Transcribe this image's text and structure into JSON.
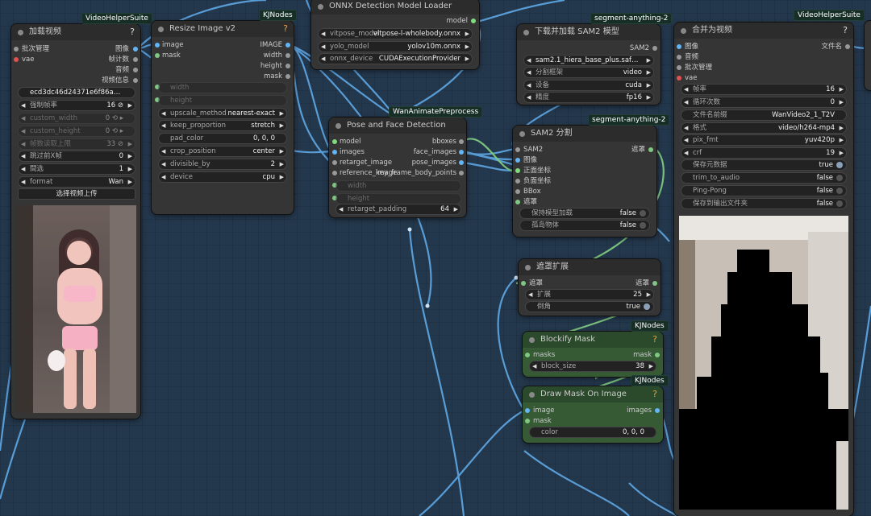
{
  "nodes": {
    "load_video": {
      "title": "加载视频",
      "badge": "VideoHelperSuite",
      "inputs": [
        "批次管理",
        "vae"
      ],
      "outputs": [
        "图像",
        "帧计数",
        "音频",
        "视频信息"
      ],
      "video_name": "ecd3dc46d24371e6f86a5d9 ...",
      "force_rate": {
        "label": "强制帧率",
        "value": "16 ⊘"
      },
      "custom_width": {
        "label": "custom_width",
        "value": "0 ⟲ ▸"
      },
      "custom_height": {
        "label": "custom_height",
        "value": "0 ⟲ ▸"
      },
      "frame_cap": {
        "label": "帧数读取上限",
        "value": "33 ⊘"
      },
      "skip_first": {
        "label": "跳过前X帧",
        "value": "0"
      },
      "select_nth": {
        "label": "間选",
        "value": "1"
      },
      "format": {
        "label": "format",
        "value": "Wan"
      },
      "upload_label": "选择视频上传"
    },
    "resize": {
      "title": "Resize Image v2",
      "badge": "KJNodes",
      "inputs": [
        "image",
        "mask"
      ],
      "outputs": [
        "IMAGE",
        "width",
        "height",
        "mask"
      ],
      "grey_inputs": [
        "width",
        "height"
      ],
      "widgets": [
        {
          "label": "upscale_method",
          "value": "nearest-exact"
        },
        {
          "label": "keep_proportion",
          "value": "stretch"
        },
        {
          "label": "pad_color",
          "value": "0, 0, 0"
        },
        {
          "label": "crop_position",
          "value": "center"
        },
        {
          "label": "divisible_by",
          "value": "2"
        },
        {
          "label": "device",
          "value": "cpu"
        }
      ]
    },
    "onnx": {
      "title": "ONNX Detection Model Loader",
      "output": "model",
      "widgets": [
        {
          "label": "vitpose_model",
          "value": "vitpose-l-wholebody.onnx"
        },
        {
          "label": "yolo_model",
          "value": "yolov10m.onnx"
        },
        {
          "label": "onnx_device",
          "value": "CUDAExecutionProvider"
        }
      ]
    },
    "pose": {
      "title": "Pose and Face Detection",
      "badge": "WanAnimatePreprocess",
      "inputs": [
        "model",
        "images",
        "retarget_image",
        "reference_image"
      ],
      "outputs": [
        "bboxes",
        "face_images",
        "pose_images",
        "key_frame_body_points"
      ],
      "grey_inputs": [
        "width",
        "height"
      ],
      "widget": {
        "label": "retarget_padding",
        "value": "64"
      }
    },
    "sam2_load": {
      "title": "下载并加载 SAM2 模型",
      "badge": "segment-anything-2",
      "output": "SAM2",
      "widgets": [
        {
          "label": "",
          "value": "sam2.1_hiera_base_plus.safete ..."
        },
        {
          "label": "分割框架",
          "value": "video"
        },
        {
          "label": "设备",
          "value": "cuda"
        },
        {
          "label": "精度",
          "value": "fp16"
        }
      ]
    },
    "sam2_seg": {
      "title": "SAM2 分割",
      "badge": "segment-anything-2",
      "inputs": [
        "SAM2",
        "图像",
        "正面坐标",
        "负面坐标",
        "BBox",
        "遮罩"
      ],
      "output": "遮罩",
      "toggles": [
        {
          "label": "保持模型加载",
          "value": "false"
        },
        {
          "label": "孤岛物体",
          "value": "false"
        }
      ]
    },
    "grow_mask": {
      "title": "遮罩扩展",
      "input": "遮罩",
      "output": "遮罩",
      "expand": {
        "label": "扩展",
        "value": "25"
      },
      "tapered": {
        "label": "倒角",
        "value": "true"
      }
    },
    "blockify": {
      "title": "Blockify Mask",
      "badge": "KJNodes",
      "input": "masks",
      "output": "mask",
      "widget": {
        "label": "block_size",
        "value": "38"
      }
    },
    "draw_mask": {
      "title": "Draw Mask On Image",
      "badge": "KJNodes",
      "inputs": [
        "image",
        "mask"
      ],
      "output": "images",
      "color": {
        "label": "color",
        "value": "0, 0, 0"
      }
    },
    "combine": {
      "title": "合并为视频",
      "badge": "VideoHelperSuite",
      "inputs": [
        "图像",
        "音频",
        "批次管理",
        "vae"
      ],
      "output": "文件名",
      "widgets": [
        {
          "label": "帧率",
          "value": "16"
        },
        {
          "label": "循环次数",
          "value": "0"
        },
        {
          "label": "文件名前缀",
          "value": "WanVideo2_1_T2V"
        },
        {
          "label": "格式",
          "value": "video/h264-mp4"
        },
        {
          "label": "pix_fmt",
          "value": "yuv420p"
        },
        {
          "label": "crf",
          "value": "19"
        }
      ],
      "toggles": [
        {
          "label": "保存元数据",
          "value": "true"
        },
        {
          "label": "trim_to_audio",
          "value": "false"
        },
        {
          "label": "Ping-Pong",
          "value": "false"
        },
        {
          "label": "保存到输出文件夹",
          "value": "false"
        }
      ]
    }
  },
  "colors": {
    "canvas": "#24384d",
    "node": "#353535",
    "node_green": "#355a34",
    "wire_image": "#64b5f6",
    "wire_mask": "#81c784",
    "badge_bg": "#162e26"
  }
}
